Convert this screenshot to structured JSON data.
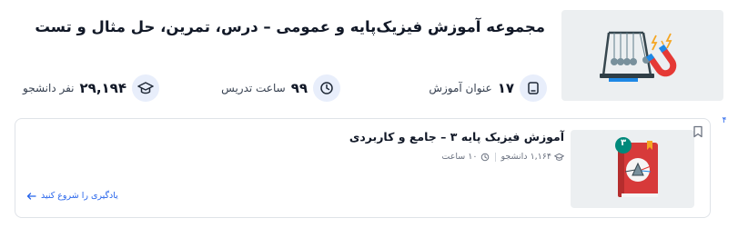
{
  "course": {
    "title": "مجموعه آموزش فیزیک‌پایه و عمومی – درس، تمرین، حل مثال و تست"
  },
  "stats": {
    "lessons": {
      "value": "۱۷",
      "label": "عنوان آموزش",
      "icon": "lessons-icon"
    },
    "hours": {
      "value": "۹۹",
      "label": "ساعت تدریس",
      "icon": "clock-icon"
    },
    "students": {
      "value": "۲۹,۱۹۴",
      "label": "نفر دانشجو",
      "icon": "graduation-cap-icon"
    }
  },
  "sections": {
    "count": "۴",
    "items": [
      {
        "badge": "۳",
        "title": "آموزش فیزیک پایه ۳ – جامع و کاربردی",
        "students": "۱,۱۶۴ دانشجو",
        "hours": "۱۰ ساعت",
        "cta": "یادگیری را شروع کنید"
      }
    ]
  },
  "colors": {
    "accent": "#2563eb",
    "stat_icon_bg": "#e8eefb",
    "thumb_bg": "#eceff1",
    "book_red": "#d73a3a",
    "magnet_red": "#e53935",
    "magnet_blue": "#1e88e5",
    "spark_orange": "#f5a623"
  }
}
